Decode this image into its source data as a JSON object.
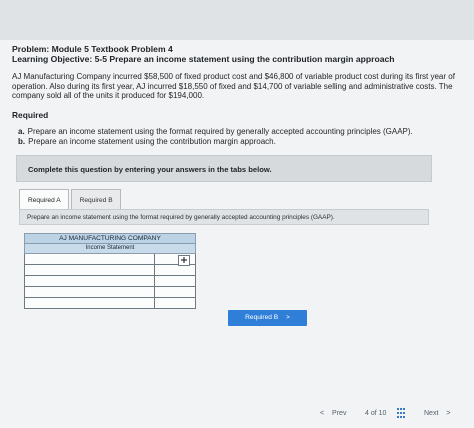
{
  "problem": {
    "title": "Problem: Module 5 Textbook Problem 4",
    "objective": "Learning Objective: 5-5 Prepare an income statement using the contribution margin approach",
    "intro": "AJ Manufacturing Company incurred $58,500 of fixed product cost and $46,800 of variable product cost during its first year of operation. Also during its first year, AJ incurred $18,550 of fixed and $14,700 of variable selling and administrative costs. The company sold all of the units it produced for $194,000."
  },
  "required": {
    "heading": "Required",
    "items": [
      {
        "letter": "a.",
        "text": "Prepare an income statement using the format required by generally accepted accounting principles (GAAP)."
      },
      {
        "letter": "b.",
        "text": "Prepare an income statement using the contribution margin approach."
      }
    ]
  },
  "instructions": "Complete this question by entering your answers in the tabs below.",
  "tabs": [
    {
      "label": "Required A",
      "active": true
    },
    {
      "label": "Required B",
      "active": false
    }
  ],
  "panel": {
    "prompt": "Prepare an income statement using the format required by generally accepted accounting principles (GAAP)."
  },
  "statement": {
    "company": "AJ MANUFACTURING COMPANY",
    "title": "Income Statement",
    "rows": [
      {
        "label": "",
        "value": ""
      },
      {
        "label": "",
        "value": ""
      },
      {
        "label": "",
        "value": ""
      },
      {
        "label": "",
        "value": ""
      },
      {
        "label": "",
        "value": ""
      }
    ]
  },
  "nav": {
    "next_tab_button": "Required B",
    "next_tab_chevron": ">",
    "prev_label": "Prev",
    "prev_chevron": "<",
    "page_current": "4",
    "page_of": "of",
    "page_total": "10",
    "next_label": "Next",
    "next_chevron": ">"
  },
  "icons": {
    "add_row": "plus-icon",
    "page_grid": "grid-icon"
  },
  "colors": {
    "primary_button": "#2f7fd9",
    "statement_header": "#bcd3e6"
  }
}
